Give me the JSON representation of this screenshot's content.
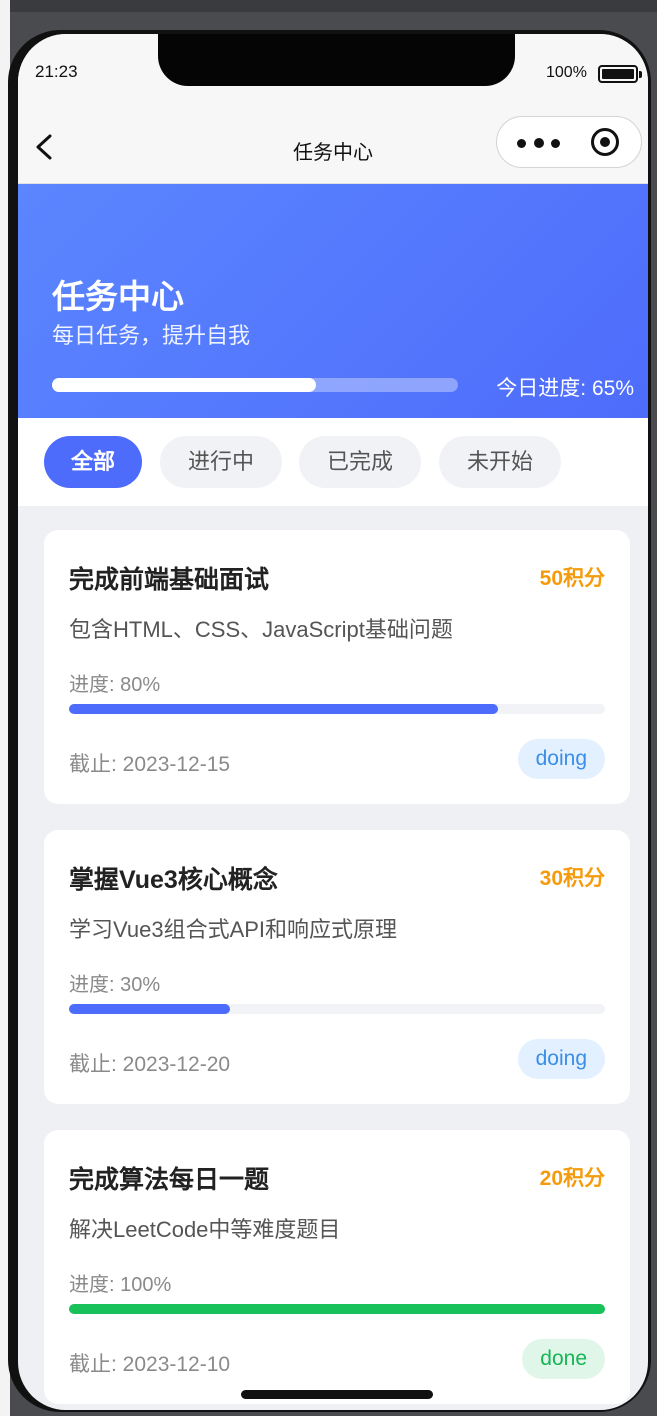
{
  "status_bar": {
    "time": "21:23",
    "battery": "100%"
  },
  "navbar": {
    "title": "任务中心"
  },
  "hero": {
    "title": "任务中心",
    "subtitle": "每日任务，提升自我",
    "progress_label": "今日进度: 65%",
    "progress": 0.65
  },
  "tabs": [
    {
      "label": "全部",
      "active": true
    },
    {
      "label": "进行中",
      "active": false
    },
    {
      "label": "已完成",
      "active": false
    },
    {
      "label": "未开始",
      "active": false
    }
  ],
  "tasks": [
    {
      "title": "完成前端基础面试",
      "points": "50积分",
      "description": "包含HTML、CSS、JavaScript基础问题",
      "progress_label": "进度: 80%",
      "progress": 0.8,
      "deadline": "截止: 2023-12-15",
      "status": "doing"
    },
    {
      "title": "掌握Vue3核心概念",
      "points": "30积分",
      "description": "学习Vue3组合式API和响应式原理",
      "progress_label": "进度: 30%",
      "progress": 0.3,
      "deadline": "截止: 2023-12-20",
      "status": "doing"
    },
    {
      "title": "完成算法每日一题",
      "points": "20积分",
      "description": "解决LeetCode中等难度题目",
      "progress_label": "进度: 100%",
      "progress": 1.0,
      "deadline": "截止: 2023-12-10",
      "status": "done"
    }
  ],
  "colors": {
    "primary": "#4e6cfb",
    "points": "#f59a0b",
    "done": "#18c15a"
  },
  "icons": {
    "back": "chevron-left-icon",
    "more": "more-dots-icon",
    "close": "target-circle-icon"
  }
}
